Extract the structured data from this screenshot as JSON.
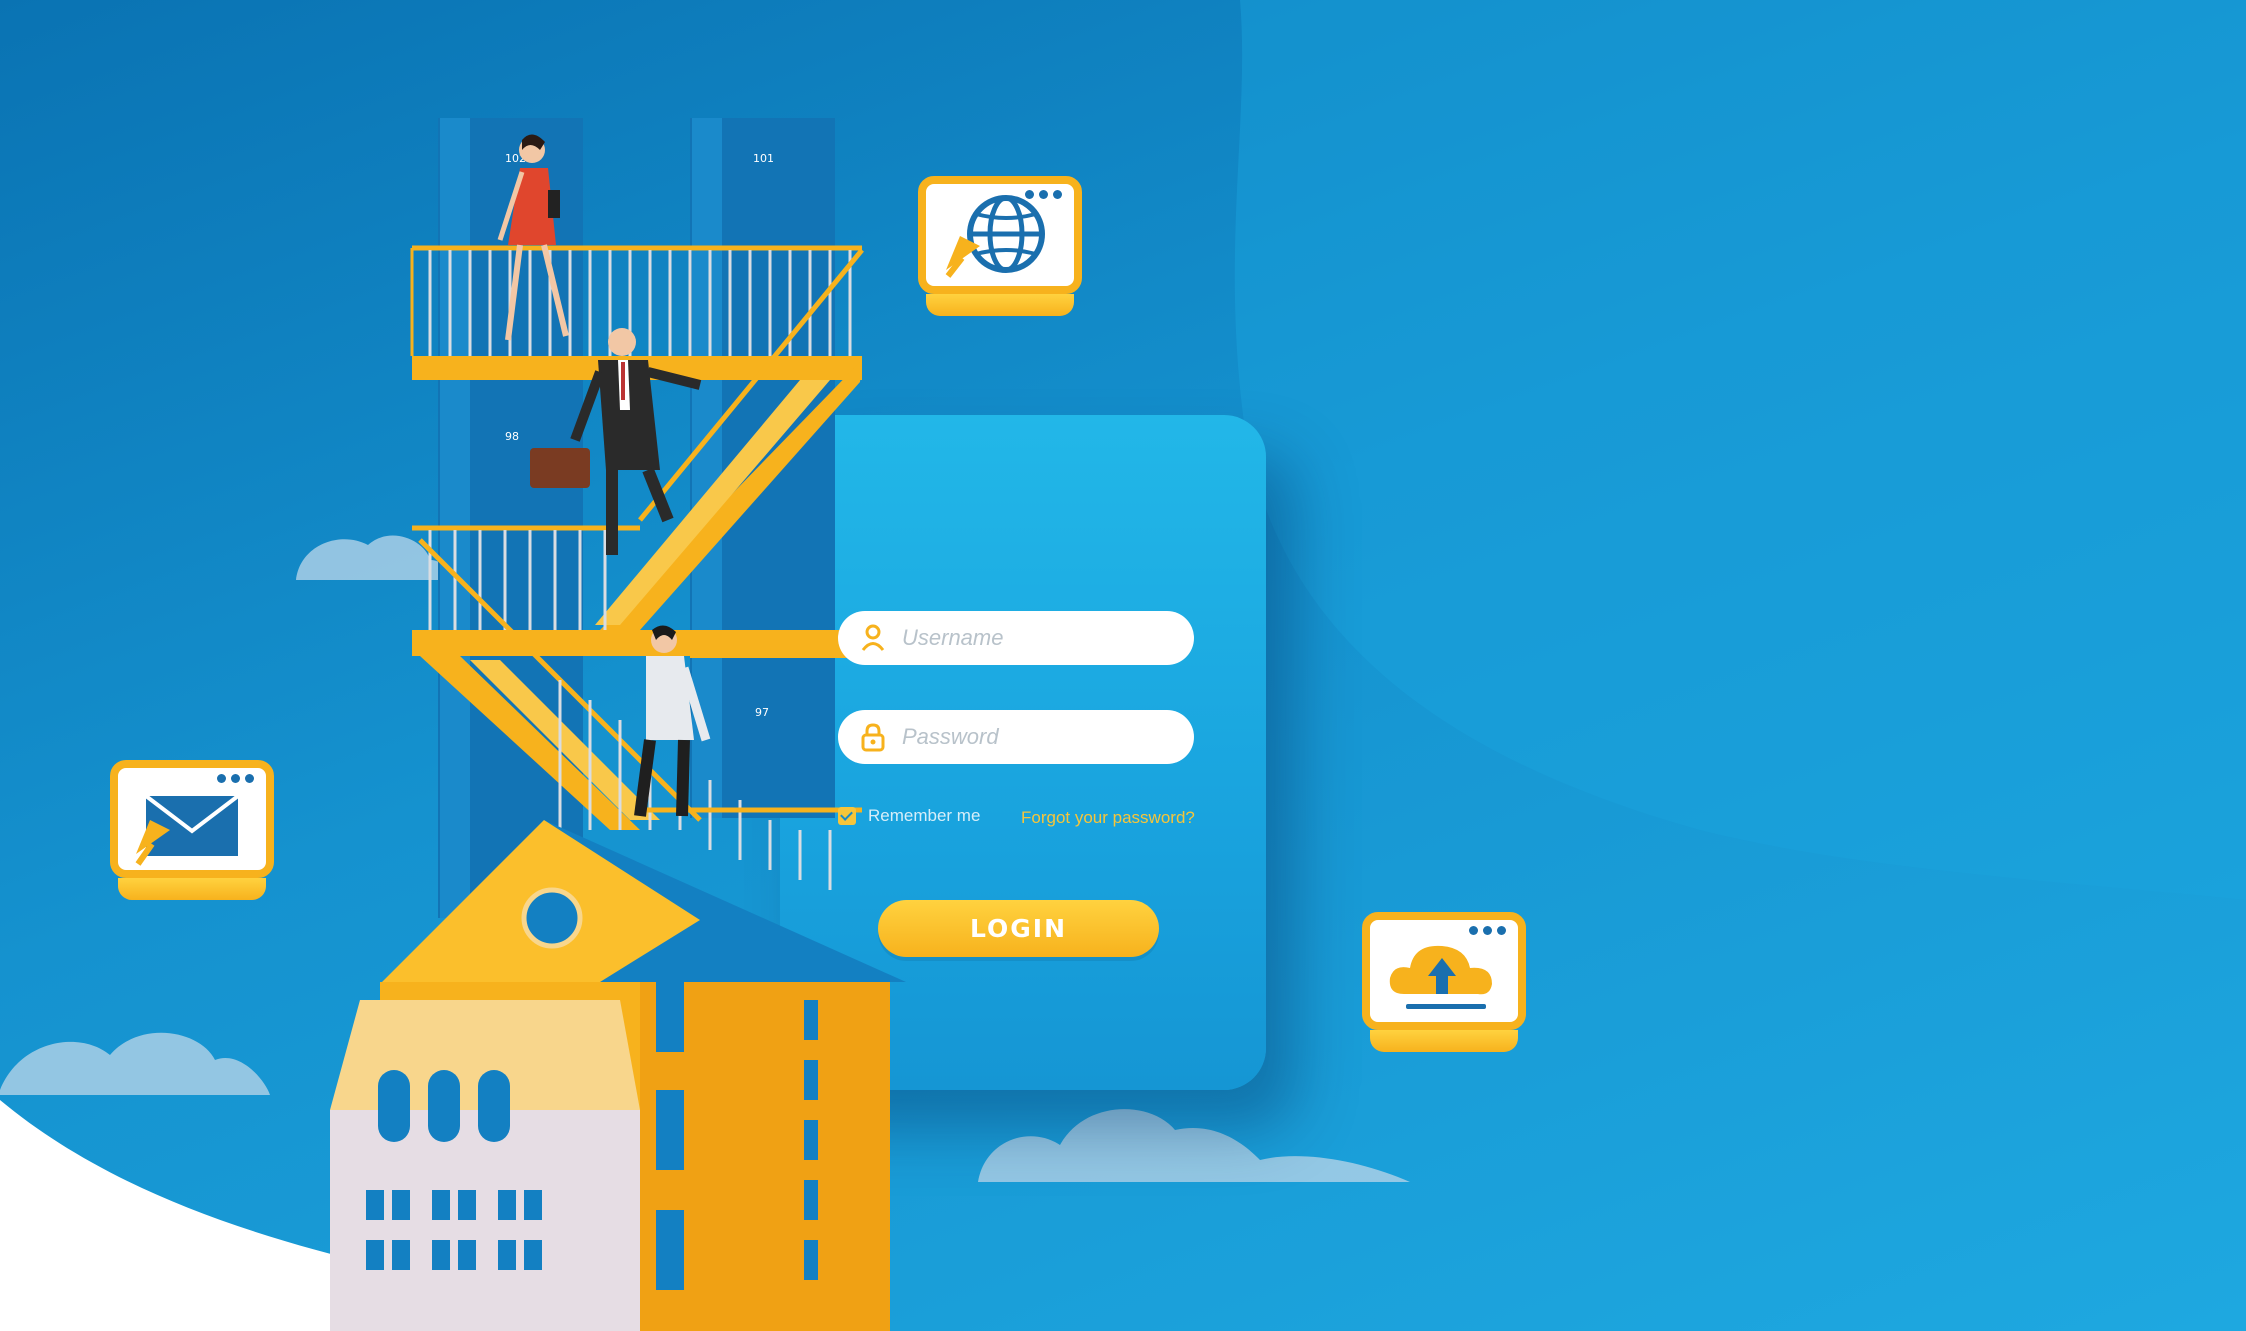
{
  "login_form": {
    "username_placeholder": "Username",
    "password_placeholder": "Password",
    "remember_label": "Remember me",
    "forgot_link": "Forgot your password?",
    "login_button": "LOGIN"
  },
  "door_numbers": {
    "top_left": "102",
    "top_right": "101",
    "middle_left": "98",
    "lower_right": "97"
  },
  "icons": {
    "globe_monitor": "globe-cursor-icon",
    "mail_monitor": "envelope-cursor-icon",
    "cloud_monitor": "cloud-upload-icon",
    "username_icon": "user-icon",
    "password_icon": "lock-icon"
  },
  "colors": {
    "background": "#1592cf",
    "card": "#22b7e8",
    "accent_yellow": "#f7b21d",
    "white": "#ffffff"
  }
}
